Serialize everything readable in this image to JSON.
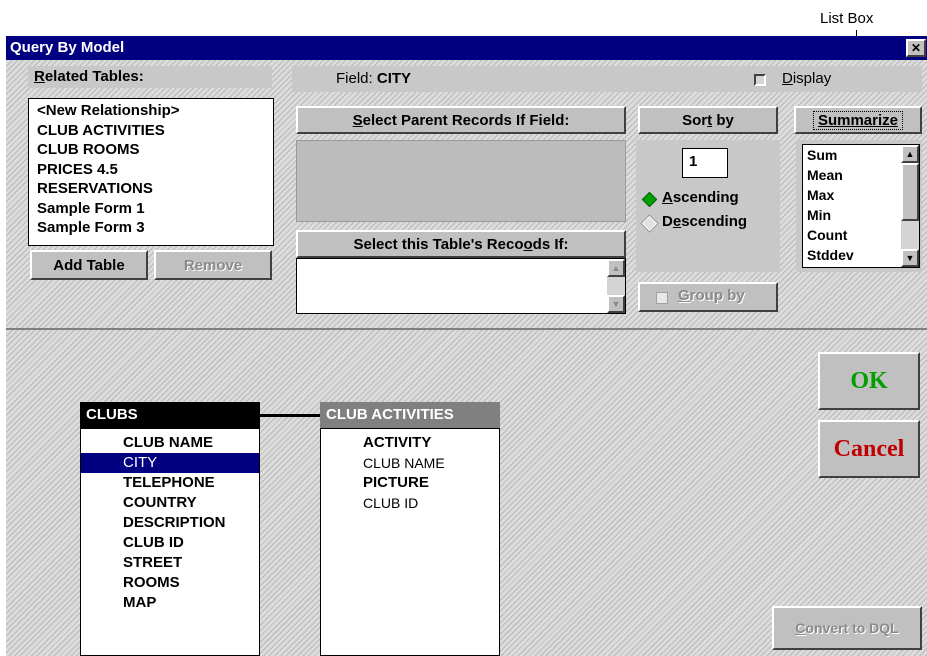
{
  "annotation": {
    "list_box": "List Box"
  },
  "window": {
    "title": "Query By Model",
    "close_glyph": "✕"
  },
  "related_tables": {
    "label": "Related Tables:",
    "items": [
      "<New Relationship>",
      "CLUB ACTIVITIES",
      "CLUB ROOMS",
      "PRICES 4.5",
      "RESERVATIONS",
      "Sample Form 1",
      "Sample Form 3"
    ],
    "add_table": "Add Table",
    "remove": "Remove"
  },
  "field": {
    "prefix": "Field:",
    "name": "CITY",
    "display_label": "Display"
  },
  "parent_records": {
    "label": "Select Parent Records If Field:"
  },
  "table_records": {
    "label": "Select this Table's Records If:"
  },
  "sort": {
    "label": "Sort by",
    "value": "1",
    "ascending": "Ascending",
    "descending": "Descending",
    "selected": "Ascending"
  },
  "group_by": {
    "label": "Group by"
  },
  "summarize": {
    "label": "Summarize",
    "items": [
      "Sum",
      "Mean",
      "Max",
      "Min",
      "Count",
      "Stddev"
    ]
  },
  "buttons": {
    "ok": "OK",
    "cancel": "Cancel",
    "convert": "Convert to DQL"
  },
  "tables": {
    "clubs": {
      "title": "CLUBS",
      "fields": [
        "CLUB NAME",
        "CITY",
        "TELEPHONE",
        "COUNTRY",
        "DESCRIPTION",
        "CLUB ID",
        "STREET",
        "ROOMS",
        "MAP"
      ],
      "selected": "CITY"
    },
    "activities": {
      "title": "CLUB ACTIVITIES",
      "fields": [
        "ACTIVITY",
        "CLUB NAME",
        "PICTURE",
        "CLUB ID"
      ],
      "bold_fields": [
        "ACTIVITY",
        "PICTURE"
      ]
    }
  },
  "colors": {
    "titlebar": "#000080",
    "ok": "#00a000",
    "cancel": "#c00000",
    "selection": "#000080"
  }
}
